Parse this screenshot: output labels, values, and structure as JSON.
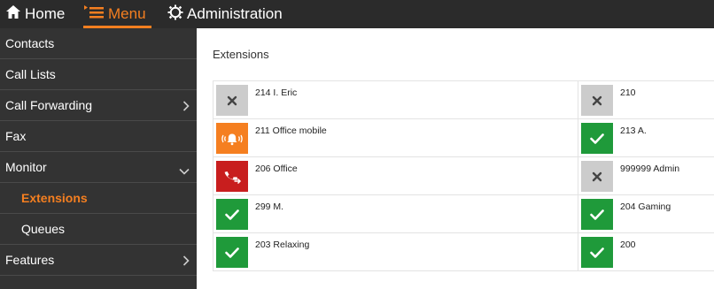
{
  "topbar": {
    "home_label": "Home",
    "menu_label": "Menu",
    "admin_label": "Administration",
    "accent": "#f57f20"
  },
  "sidebar": {
    "items": [
      {
        "label": "Contacts"
      },
      {
        "label": "Call Lists"
      },
      {
        "label": "Call Forwarding",
        "chevron": "chevron-right-icon"
      },
      {
        "label": "Fax"
      },
      {
        "label": "Monitor",
        "chevron": "chevron-down-icon"
      },
      {
        "label": "Extensions",
        "active": true
      },
      {
        "label": "Queues"
      },
      {
        "label": "Features",
        "chevron": "chevron-right-icon"
      }
    ]
  },
  "main": {
    "title": "Extensions",
    "rows": [
      {
        "left": {
          "label": "214 I. Eric",
          "status": "offline",
          "icon": "x-icon",
          "color": "#cccccc"
        },
        "right": {
          "label": "210",
          "status": "offline",
          "icon": "x-icon",
          "color": "#cccccc"
        }
      },
      {
        "left": {
          "label": "211 Office mobile",
          "status": "ringing",
          "icon": "bell-ringing-icon",
          "color": "#f57f20"
        },
        "right": {
          "label": "213 A.",
          "status": "available",
          "icon": "check-icon",
          "color": "#1f9a3a"
        }
      },
      {
        "left": {
          "label": "206 Office",
          "status": "on-call",
          "icon": "phone-outgoing-icon",
          "color": "#c81e1e"
        },
        "right": {
          "label": "999999 Admin",
          "status": "offline",
          "icon": "x-icon",
          "color": "#cccccc"
        }
      },
      {
        "left": {
          "label": "299 M.",
          "status": "available",
          "icon": "check-icon",
          "color": "#1f9a3a"
        },
        "right": {
          "label": "204 Gaming",
          "status": "available",
          "icon": "check-icon",
          "color": "#1f9a3a"
        }
      },
      {
        "left": {
          "label": "203 Relaxing",
          "status": "available",
          "icon": "check-icon",
          "color": "#1f9a3a"
        },
        "right": {
          "label": "200",
          "status": "available",
          "icon": "check-icon",
          "color": "#1f9a3a"
        }
      }
    ]
  }
}
